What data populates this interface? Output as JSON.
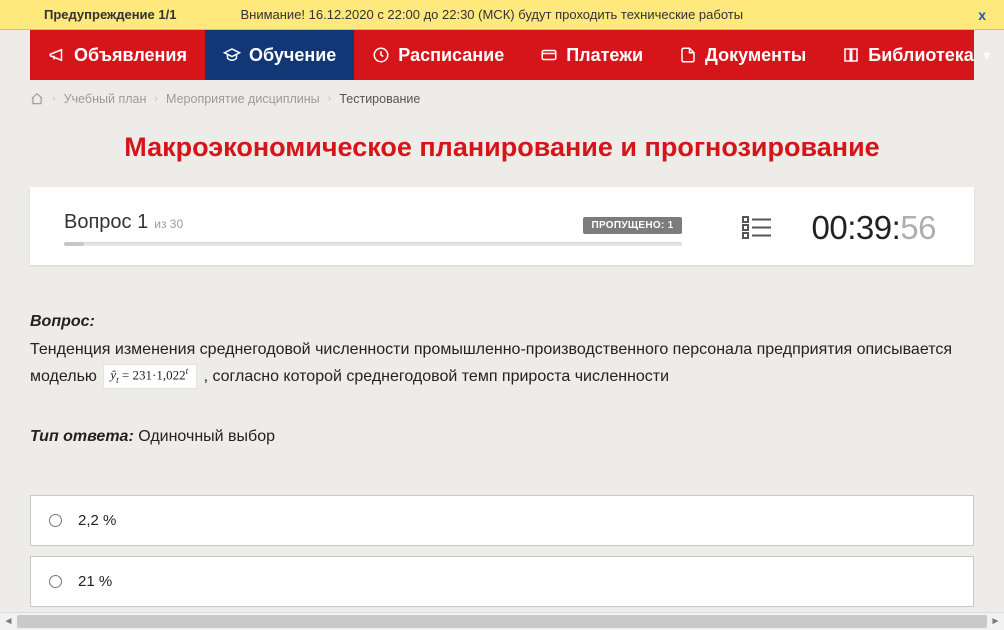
{
  "alert": {
    "title": "Предупреждение 1/1",
    "text": "Внимание! 16.12.2020 с 22:00 до 22:30 (МСК) будут проходить технические работы",
    "close": "x"
  },
  "nav": {
    "items": [
      {
        "label": "Объявления",
        "icon": "megaphone-icon",
        "active": false
      },
      {
        "label": "Обучение",
        "icon": "graduation-icon",
        "active": true
      },
      {
        "label": "Расписание",
        "icon": "clock-icon",
        "active": false
      },
      {
        "label": "Платежи",
        "icon": "card-icon",
        "active": false
      },
      {
        "label": "Документы",
        "icon": "file-icon",
        "active": false
      },
      {
        "label": "Библиотека",
        "icon": "book-icon",
        "active": false,
        "chevron": true
      }
    ]
  },
  "breadcrumbs": {
    "items": [
      {
        "label": "Учебный план",
        "current": false
      },
      {
        "label": "Мероприятие дисциплины",
        "current": false
      },
      {
        "label": "Тестирование",
        "current": true
      }
    ]
  },
  "page_title": "Макроэкономическое планирование и прогнозирование",
  "status": {
    "question_word": "Вопрос",
    "question_num": "1",
    "of_text": "из 30",
    "skipped_badge": "ПРОПУЩЕНО: 1",
    "timer_main": "00:39:",
    "timer_sec": "56",
    "progress_pct": 3.3
  },
  "question": {
    "label": "Вопрос:",
    "text_before": "Тенденция изменения среднегодовой численности промышленно-производственного персонала предприятия описывается моделью ",
    "formula_display": "ŷₜ = 231·1,022ᵗ",
    "text_after": " , согласно которой среднегодовой темп прироста численности",
    "answer_type_label": "Тип ответа:",
    "answer_type_value": " Одиночный выбор"
  },
  "options": [
    {
      "label": "2,2 %"
    },
    {
      "label": "21 %"
    }
  ]
}
